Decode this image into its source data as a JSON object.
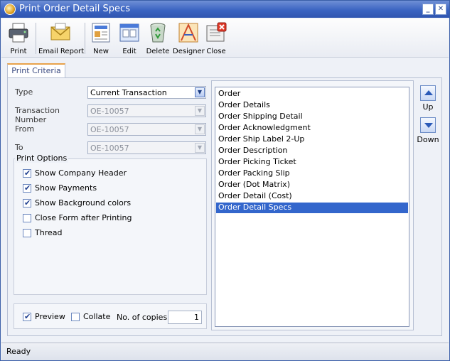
{
  "window": {
    "title": "Print Order Detail Specs"
  },
  "toolbar": {
    "print": "Print",
    "email_report": "Email Report",
    "new": "New",
    "edit": "Edit",
    "delete": "Delete",
    "designer": "Designer",
    "close": "Close"
  },
  "tabs": {
    "print_criteria": "Print Criteria"
  },
  "criteria": {
    "type_label": "Type",
    "type_value": "Current Transaction",
    "transaction_number_label": "Transaction Number",
    "transaction_number_value": "OE-10057",
    "from_label": "From",
    "from_value": "OE-10057",
    "to_label": "To",
    "to_value": "OE-10057"
  },
  "print_options": {
    "title": "Print Options",
    "items": [
      {
        "label": "Show Company Header",
        "checked": true
      },
      {
        "label": "Show Payments",
        "checked": true
      },
      {
        "label": "Show Background colors",
        "checked": true
      },
      {
        "label": "Close Form after Printing",
        "checked": false
      },
      {
        "label": "Thread",
        "checked": false
      }
    ]
  },
  "bottom": {
    "preview_label": "Preview",
    "preview_checked": true,
    "collate_label": "Collate",
    "collate_checked": false,
    "copies_label": "No. of copies",
    "copies_value": "1"
  },
  "reports": {
    "items": [
      "Order",
      "Order Details",
      "Order Shipping Detail",
      "Order Acknowledgment",
      "Order Ship Label 2-Up",
      "Order Description",
      "Order Picking Ticket",
      "Order Packing Slip",
      "Order (Dot Matrix)",
      "Order Detail (Cost)",
      "Order Detail Specs"
    ],
    "selected": "Order Detail Specs"
  },
  "move": {
    "up": "Up",
    "down": "Down"
  },
  "status": {
    "text": "Ready"
  },
  "colors": {
    "title_bar": "#3b64c2",
    "selection": "#3366cc",
    "tab_accent": "#e8a24a"
  }
}
